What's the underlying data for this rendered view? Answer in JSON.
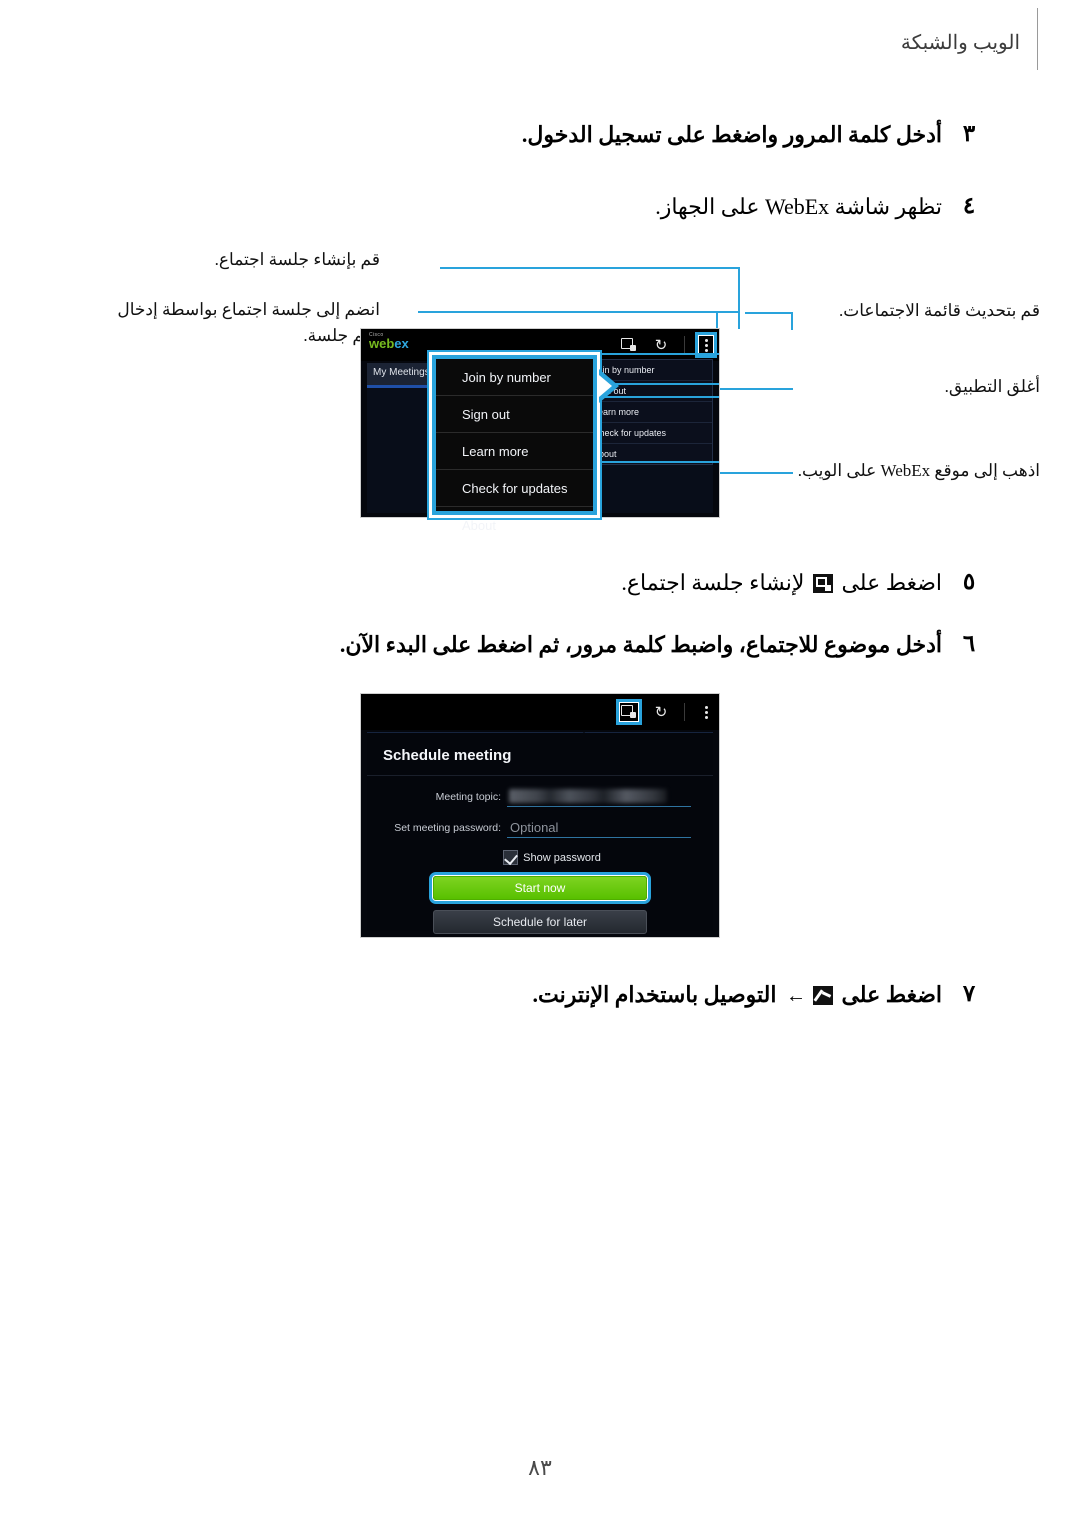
{
  "header": {
    "title": "الويب والشبكة"
  },
  "steps": [
    {
      "num": "٣",
      "text_before": "أدخل كلمة المرور واضغط على ",
      "bold_part": "تسجيل الدخول",
      "text_after": "."
    },
    {
      "num": "٤",
      "text": "تظهر شاشة WebEx على الجهاز."
    },
    {
      "num": "٥",
      "text_before": "اضغط على ",
      "icon": "new-meeting-icon",
      "text_after": " لإنشاء جلسة اجتماع."
    },
    {
      "num": "٦",
      "text_before": "أدخل موضوع للاجتماع، واضبط كلمة مرور، ثم اضغط على ",
      "bold_part": "البدء الآن",
      "text_after": "."
    },
    {
      "num": "٧",
      "text_before": "اضغط على ",
      "icon": "connect-icon",
      "arrow": "←",
      "bold_part": " التوصيل باستخدام الإنترنت",
      "text_after": "."
    }
  ],
  "annotations": {
    "left": [
      {
        "text": "قم بإنشاء جلسة اجتماع."
      },
      {
        "text": "انضم إلى جلسة اجتماع بواسطة إدخال رقم جلسة."
      }
    ],
    "right": [
      {
        "text": "قم بتحديث قائمة الاجتماعات."
      },
      {
        "text": "أغلق التطبيق."
      },
      {
        "text": "اذهب إلى موقع WebEx على الويب."
      }
    ]
  },
  "screenshot1": {
    "logo": {
      "brand": "Cisco",
      "web": "web",
      "ex": "ex"
    },
    "tab_label": "My Meetings",
    "toolbar_icons": [
      "new-meeting-icon",
      "refresh-icon",
      "overflow-menu-icon"
    ],
    "refresh_glyph": "↻",
    "menu_items": [
      "Join by number",
      "Sign out",
      "Learn more",
      "Check for updates",
      "About"
    ]
  },
  "callout": {
    "items": [
      "Join by number",
      "Sign out",
      "Learn more",
      "Check for updates",
      "About"
    ]
  },
  "screenshot2": {
    "toolbar_icons": [
      "new-meeting-icon",
      "refresh-icon",
      "overflow-menu-icon"
    ],
    "refresh_glyph": "↻",
    "dialog_title": "Schedule meeting",
    "fields": [
      {
        "label": "Meeting topic:",
        "value": "",
        "redacted": true
      },
      {
        "label": "Set meeting password:",
        "placeholder": "Optional",
        "value": ""
      }
    ],
    "checkbox": {
      "label": "Show password",
      "checked": true
    },
    "buttons": {
      "primary": "Start now",
      "secondary": "Schedule for later"
    }
  },
  "footer": {
    "page_number": "٨٣"
  },
  "colors": {
    "accent_cyan": "#29a3dc",
    "green_button": "#66c400",
    "webex_green": "#77bc1f",
    "webex_blue": "#2fa8e0"
  }
}
